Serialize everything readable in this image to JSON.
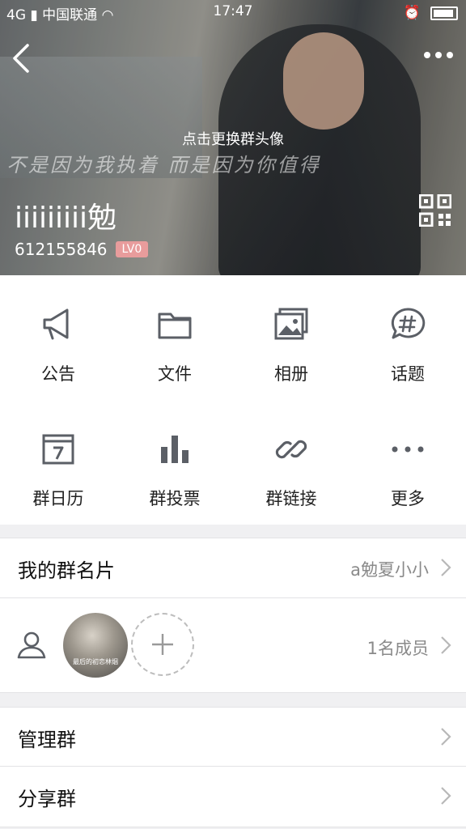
{
  "status_bar": {
    "carrier": "中国联通",
    "network": "4G",
    "time": "17:47"
  },
  "header": {
    "change_avatar_hint": "点击更换群头像",
    "banner_text": "不是因为我执着  而是因为你值得",
    "group_name": "iiiiiiiii勉",
    "group_id": "612155846",
    "level": "LV0"
  },
  "features": [
    {
      "label": "公告",
      "icon": "megaphone-icon"
    },
    {
      "label": "文件",
      "icon": "folder-icon"
    },
    {
      "label": "相册",
      "icon": "photo-album-icon"
    },
    {
      "label": "话题",
      "icon": "hashtag-bubble-icon"
    },
    {
      "label": "群日历",
      "icon": "calendar-icon"
    },
    {
      "label": "群投票",
      "icon": "bar-chart-icon"
    },
    {
      "label": "群链接",
      "icon": "link-icon"
    },
    {
      "label": "更多",
      "icon": "more-dots-icon"
    }
  ],
  "my_card": {
    "title": "我的群名片",
    "value": "a勉夏小小"
  },
  "members": {
    "count_text": "1名成员",
    "avatar_caption": "最后的初恋林烟"
  },
  "manage": {
    "title": "管理群"
  },
  "share": {
    "title": "分享群"
  },
  "colors": {
    "icon_gray": "#5b5f66",
    "level_badge": "#e89c9c",
    "text_gray": "#8a8a8a"
  }
}
